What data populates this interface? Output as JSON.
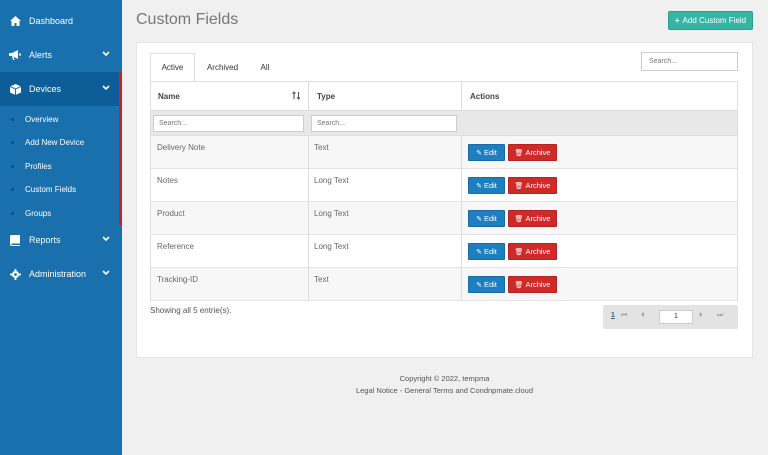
{
  "sidebar": {
    "items": [
      {
        "label": "Dashboard",
        "icon": "home-icon"
      },
      {
        "label": "Alerts",
        "icon": "bullhorn-icon"
      },
      {
        "label": "Devices",
        "icon": "cube-icon"
      },
      {
        "label": "Reports",
        "icon": "book-icon"
      },
      {
        "label": "Administration",
        "icon": "gear-icon"
      }
    ],
    "devices_subitems": [
      "Overview",
      "Add New Device",
      "Profiles",
      "Custom Fields",
      "Groups"
    ]
  },
  "header": {
    "title": "Custom Fields",
    "add_button": "Add Custom Field"
  },
  "tabs": [
    "Active",
    "Archived",
    "All"
  ],
  "search": {
    "placeholder": "Search..."
  },
  "table": {
    "columns": [
      "Name",
      "Type",
      "Actions"
    ],
    "filter_placeholder": "Search...",
    "rows": [
      {
        "name": "Delivery Note",
        "type": "Text"
      },
      {
        "name": "Notes",
        "type": "Long Text"
      },
      {
        "name": "Product",
        "type": "Long Text"
      },
      {
        "name": "Reference",
        "type": "Long Text"
      },
      {
        "name": "Tracking-ID",
        "type": "Text"
      }
    ],
    "edit_label": "Edit",
    "archive_label": "Archive"
  },
  "pagination": {
    "summary": "Showing all 5 entrie(s).",
    "current": "1",
    "page_input": "1"
  },
  "footer": {
    "copyright": "Copyright © 2022, tempma",
    "links": "Legal Notice - General Terms and Condnpmate.cloud"
  },
  "colors": {
    "sidebar": "#1a70ad",
    "accent_teal": "#36b5a5",
    "edit_blue": "#1e7fc0",
    "archive_red": "#cf2a27"
  }
}
